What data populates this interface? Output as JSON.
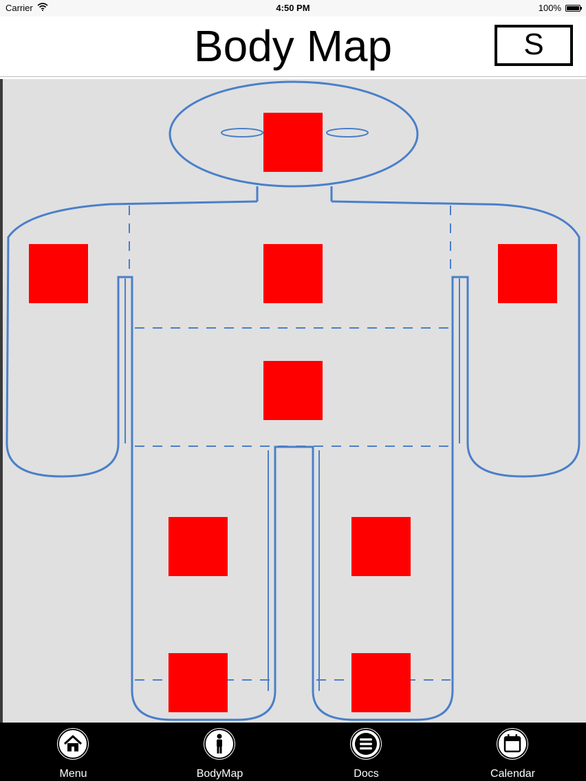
{
  "status_bar": {
    "carrier": "Carrier",
    "time": "4:50 PM",
    "battery": "100%",
    "battery_level": 1.0
  },
  "nav": {
    "title": "Body Map",
    "s_button_label": "S"
  },
  "body_map": {
    "outline_color": "#4a7fc9",
    "background_color": "#e0e0e0",
    "marker_color": "#ff0000",
    "markers": [
      {
        "region": "head"
      },
      {
        "region": "right-arm"
      },
      {
        "region": "chest"
      },
      {
        "region": "left-arm"
      },
      {
        "region": "abdomen"
      },
      {
        "region": "right-thigh"
      },
      {
        "region": "left-thigh"
      },
      {
        "region": "right-lower-leg"
      },
      {
        "region": "left-lower-leg"
      }
    ]
  },
  "tab_bar": {
    "items": [
      {
        "label": "Menu",
        "icon": "home-icon"
      },
      {
        "label": "BodyMap",
        "icon": "person-icon"
      },
      {
        "label": "Docs",
        "icon": "list-icon"
      },
      {
        "label": "Calendar",
        "icon": "calendar-icon"
      }
    ]
  }
}
